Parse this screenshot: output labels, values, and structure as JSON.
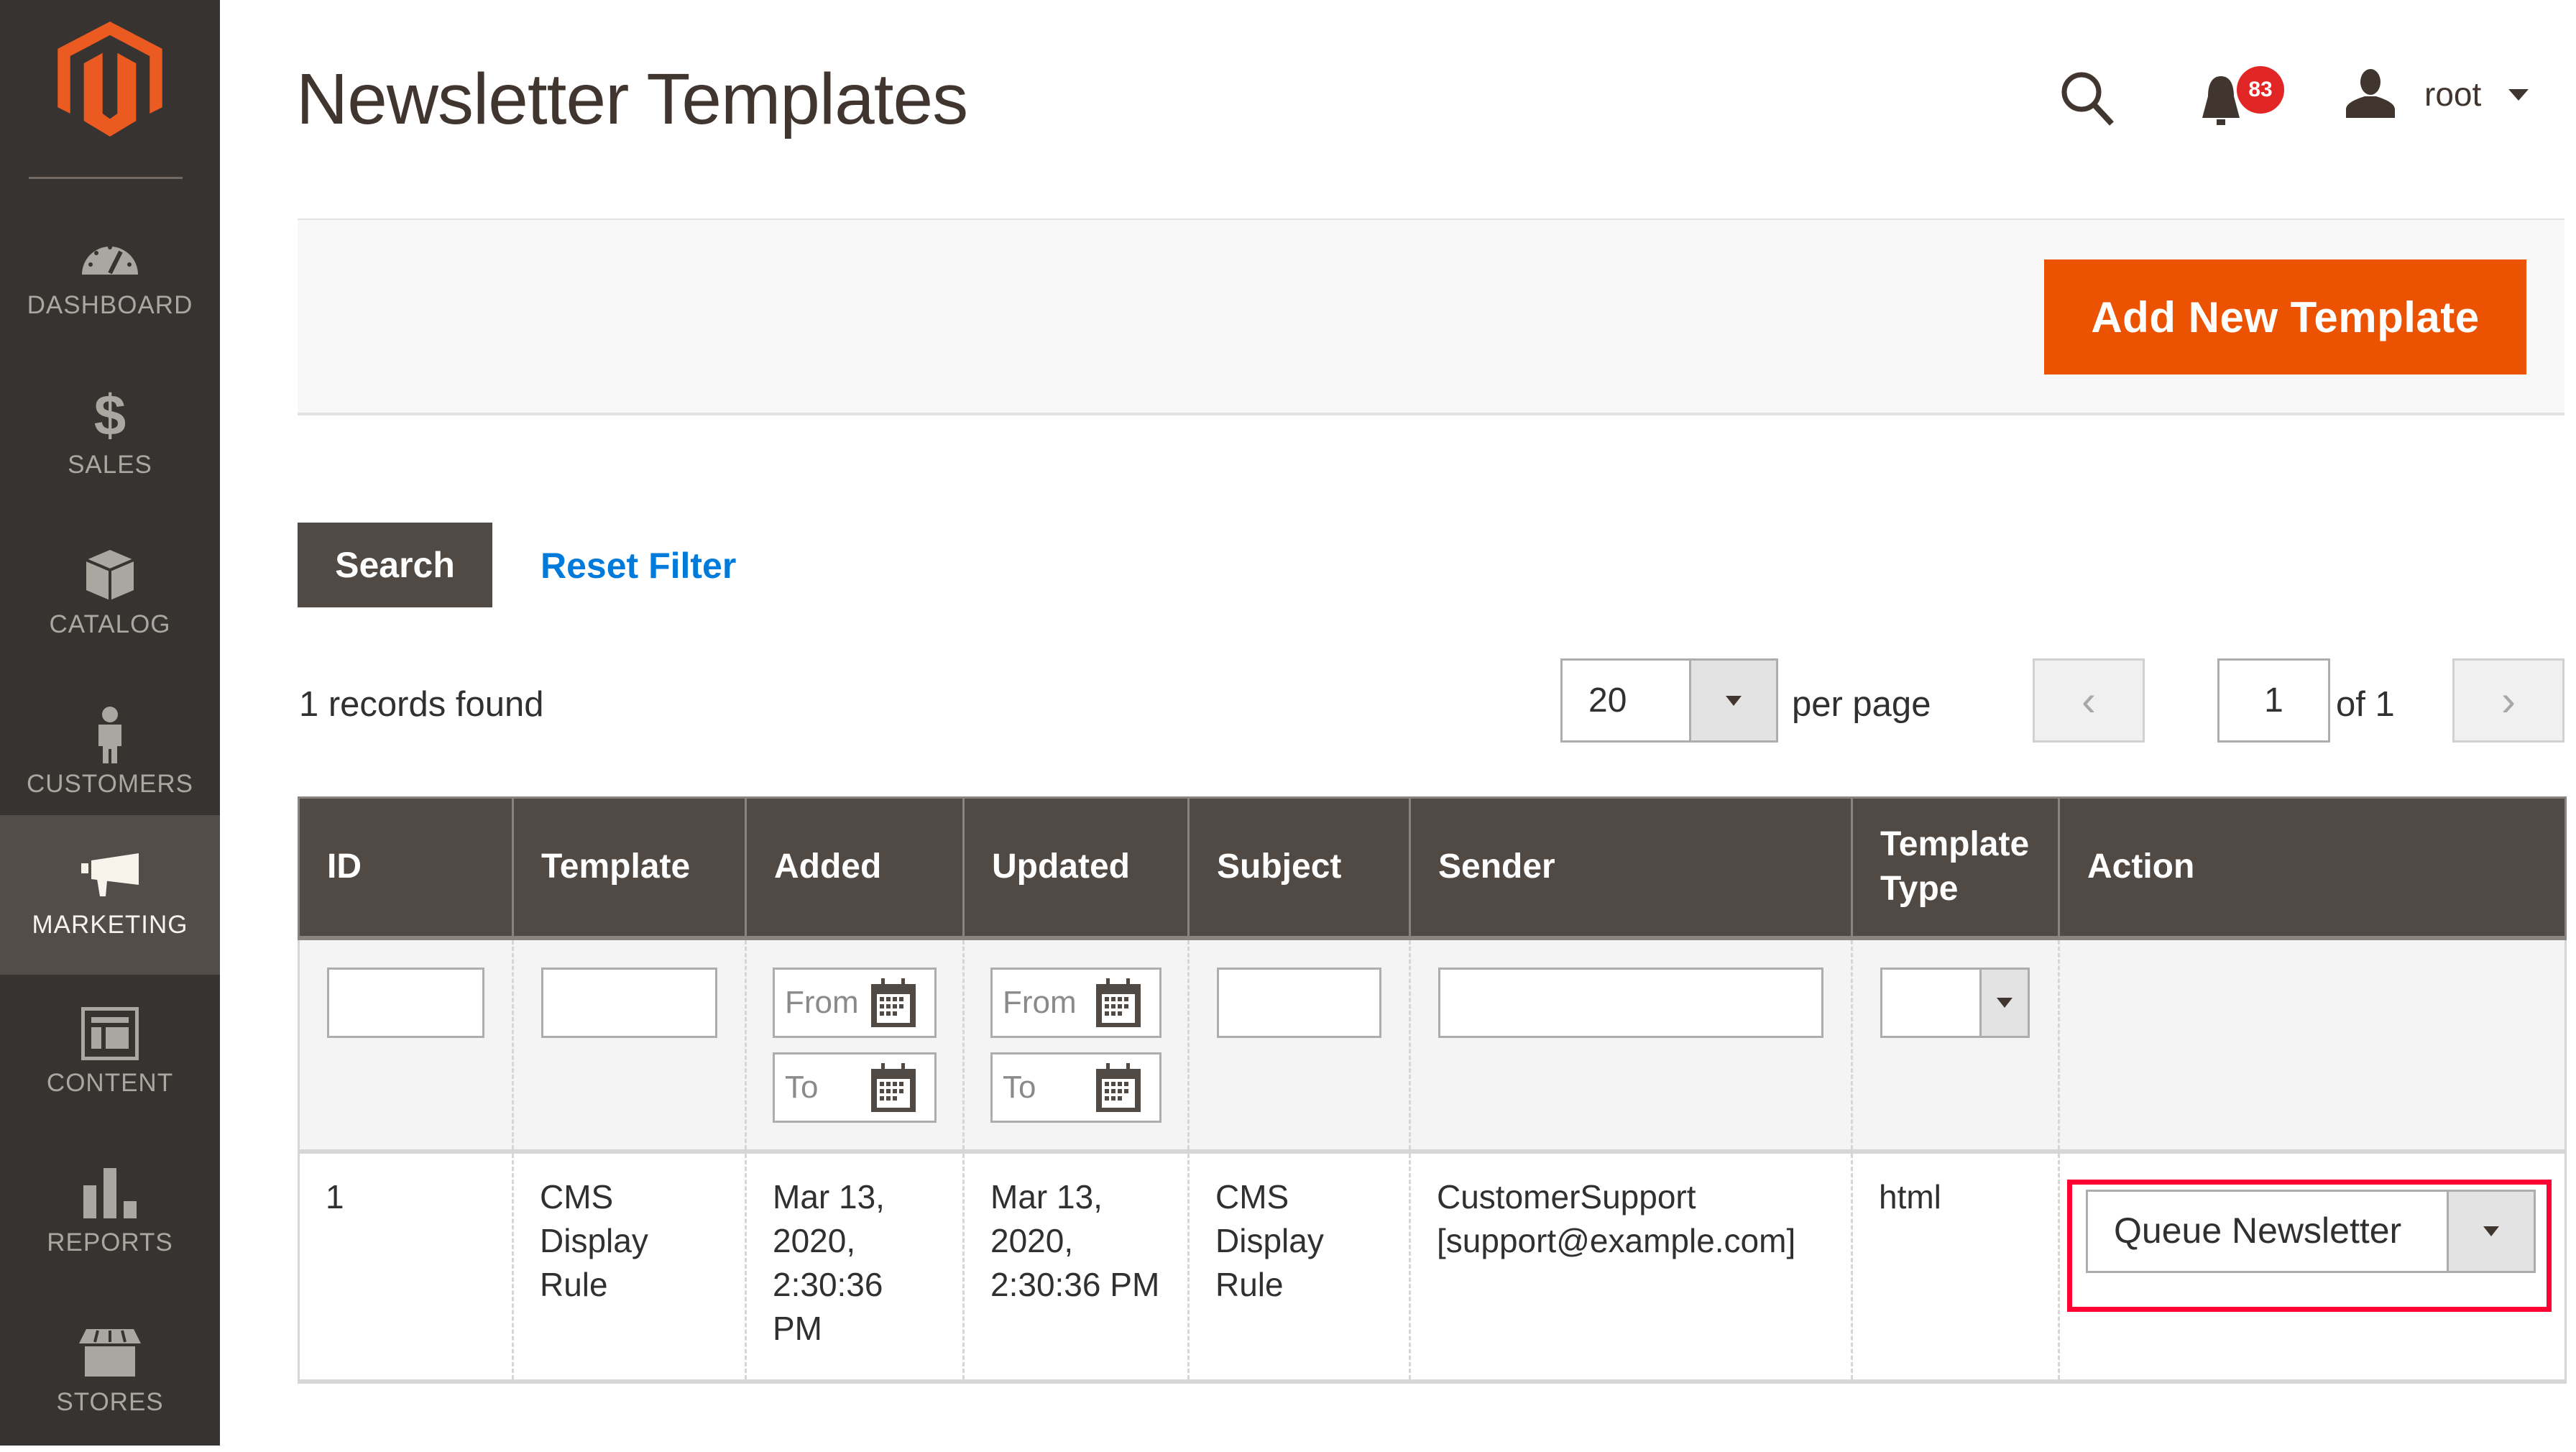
{
  "brand": {
    "accent": "#eb5202",
    "sidebar_bg": "#373330",
    "header_bg": "#514943",
    "link": "#007bdb",
    "highlight": "#ff0033"
  },
  "sidebar": {
    "logo": "magento-logo-icon",
    "items": [
      {
        "label": "Dashboard",
        "icon": "dashboard-gauge-icon",
        "active": false
      },
      {
        "label": "Sales",
        "icon": "dollar-icon",
        "active": false
      },
      {
        "label": "Catalog",
        "icon": "box-icon",
        "active": false
      },
      {
        "label": "Customers",
        "icon": "person-icon",
        "active": false
      },
      {
        "label": "Marketing",
        "icon": "megaphone-icon",
        "active": true
      },
      {
        "label": "Content",
        "icon": "layout-icon",
        "active": false
      },
      {
        "label": "Reports",
        "icon": "bar-chart-icon",
        "active": false
      },
      {
        "label": "Stores",
        "icon": "storefront-icon",
        "active": false
      }
    ]
  },
  "header": {
    "title": "Newsletter Templates",
    "notifications_count": "83",
    "user_name": "root"
  },
  "actions": {
    "add_label": "Add New Template"
  },
  "grid": {
    "search_label": "Search",
    "reset_label": "Reset Filter",
    "records_text": "1 records found",
    "per_page_value": "20",
    "per_page_label": "per page",
    "prev_glyph": "‹",
    "next_glyph": "›",
    "current_page": "1",
    "page_of": "of 1",
    "columns": [
      "ID",
      "Template",
      "Added",
      "Updated",
      "Subject",
      "Sender",
      "Template Type",
      "Action"
    ],
    "filters": {
      "from_placeholder": "From",
      "to_placeholder": "To"
    },
    "rows": [
      {
        "id": "1",
        "template": "CMS Display Rule",
        "added": "Mar 13, 2020, 2:30:36 PM",
        "updated": "Mar 13, 2020, 2:30:36 PM",
        "subject": "CMS Display Rule",
        "sender_name": "CustomerSupport",
        "sender_email": "[support@example.com]",
        "type": "html",
        "action": "Queue Newsletter"
      }
    ]
  }
}
